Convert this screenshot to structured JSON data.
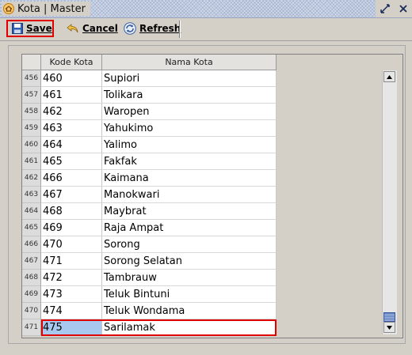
{
  "window": {
    "title": "Kota | Master"
  },
  "toolbar": {
    "save_label": "Save",
    "cancel_label": "Cancel",
    "refresh_label": "Refresh"
  },
  "table": {
    "columns": [
      "Kode Kota",
      "Nama Kota"
    ],
    "rows": [
      {
        "num": "456",
        "kode": "460",
        "nama": "Supiori"
      },
      {
        "num": "457",
        "kode": "461",
        "nama": "Tolikara"
      },
      {
        "num": "458",
        "kode": "462",
        "nama": "Waropen"
      },
      {
        "num": "459",
        "kode": "463",
        "nama": "Yahukimo"
      },
      {
        "num": "460",
        "kode": "464",
        "nama": "Yalimo"
      },
      {
        "num": "461",
        "kode": "465",
        "nama": "Fakfak"
      },
      {
        "num": "462",
        "kode": "466",
        "nama": "Kaimana"
      },
      {
        "num": "463",
        "kode": "467",
        "nama": "Manokwari"
      },
      {
        "num": "464",
        "kode": "468",
        "nama": "Maybrat"
      },
      {
        "num": "465",
        "kode": "469",
        "nama": "Raja Ampat"
      },
      {
        "num": "466",
        "kode": "470",
        "nama": "Sorong"
      },
      {
        "num": "467",
        "kode": "471",
        "nama": "Sorong Selatan"
      },
      {
        "num": "468",
        "kode": "472",
        "nama": "Tambrauw"
      },
      {
        "num": "469",
        "kode": "473",
        "nama": "Teluk Bintuni"
      },
      {
        "num": "470",
        "kode": "474",
        "nama": "Teluk Wondama"
      },
      {
        "num": "471",
        "kode": "475",
        "nama": "Sarilamak"
      }
    ],
    "selected_row": 15
  },
  "icons": {
    "app": "home-icon",
    "restore": "restore-window-icon",
    "close": "close-icon",
    "save": "floppy-disk-icon",
    "cancel": "undo-arrow-icon",
    "refresh": "refresh-icon"
  },
  "colors": {
    "selection_outline": "#e00000",
    "selected_cell": "#a8c8f0",
    "scroll_thumb": "#5d7fc2"
  }
}
